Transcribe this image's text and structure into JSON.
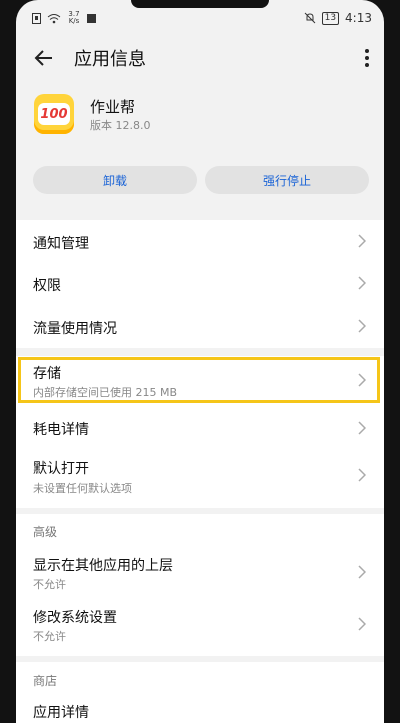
{
  "status_bar": {
    "signal_text": "3.7\nK/s",
    "battery": "13",
    "time": "4:13"
  },
  "header": {
    "title": "应用信息"
  },
  "app": {
    "name": "作业帮",
    "version": "版本 12.8.0",
    "icon_text": "100",
    "icon_color": "#ffd43b"
  },
  "buttons": {
    "uninstall": "卸载",
    "force_stop": "强行停止"
  },
  "section1": {
    "notify": "通知管理",
    "perms": "权限",
    "traffic": "流量使用情况"
  },
  "section2": {
    "storage_title": "存储",
    "storage_sub": "内部存储空间已使用 215 MB",
    "battery_title": "耗电详情",
    "default_title": "默认打开",
    "default_sub": "未设置任何默认选项"
  },
  "advanced": {
    "header": "高级",
    "overlay_title": "显示在其他应用的上层",
    "overlay_sub": "不允许",
    "modify_title": "修改系统设置",
    "modify_sub": "不允许"
  },
  "store": {
    "header": "商店",
    "detail": "应用详情"
  },
  "colors": {
    "accent": "#1a63d6",
    "highlight": "#f5c518"
  }
}
